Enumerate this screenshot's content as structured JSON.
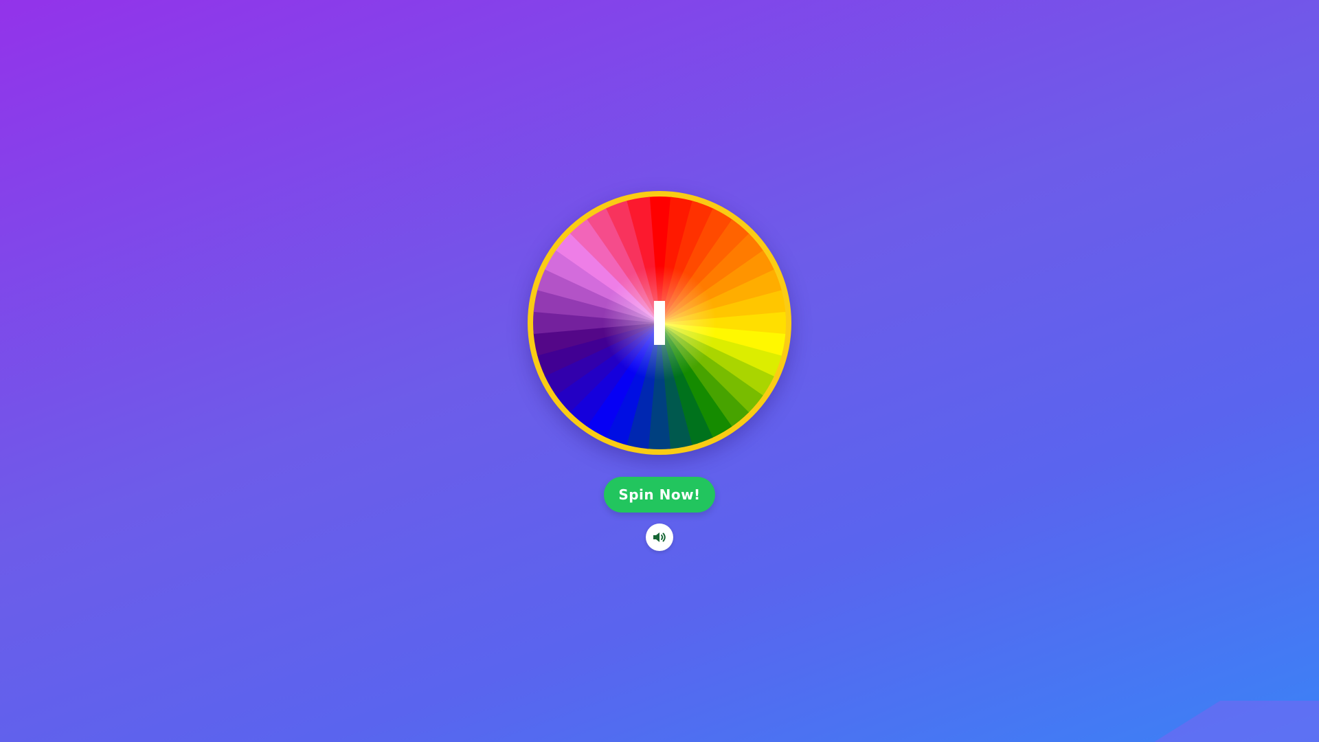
{
  "game": {
    "spin_label": "Spin Now!",
    "sound_state": "on"
  },
  "wheel": {
    "segment_count": 36,
    "rim_color": "#facc15",
    "pointer_color": "#ffffff",
    "gradient_colors": [
      "#ff0000",
      "#ff7f00",
      "#ffff00",
      "#008000",
      "#0000ff",
      "#4b0082",
      "#ee82ee",
      "#ff0000"
    ]
  },
  "colors": {
    "spin_button": "#22c55e",
    "sound_icon": "#166534"
  },
  "icons": {
    "sound": "speaker-volume-icon"
  }
}
